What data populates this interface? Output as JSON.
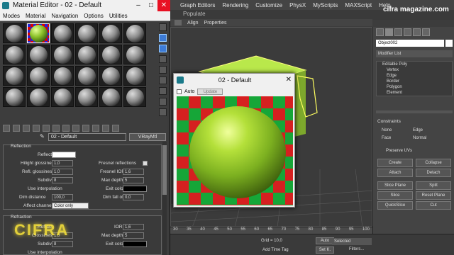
{
  "max": {
    "menu": [
      "Graph Editors",
      "Rendering",
      "Customize",
      "PhysX",
      "MyScripts",
      "MAXScript",
      "Help"
    ],
    "ribbon_text": "Populate",
    "toolbar2": [
      "Align",
      "Properties"
    ],
    "watermark": "cifra magazine.com",
    "cmd": {
      "object_name": "Object002",
      "modifier_list": "Modifier List",
      "stack": [
        "Editable Poly",
        "Vertex",
        "Edge",
        "Border",
        "Polygon",
        "Element"
      ],
      "constraints_label": "Constraints",
      "radio": [
        "None",
        "Edge",
        "Face",
        "Normal"
      ],
      "preserve_uvs": "Preserve UVs",
      "buttons": [
        "Create",
        "Collapse",
        "Attach",
        "Detach",
        "Slice Plane",
        "Split",
        "Slice",
        "Reset Plane",
        "QuickSlice",
        "Cut"
      ]
    },
    "timeline_ticks": [
      "30",
      "35",
      "40",
      "45",
      "50",
      "55",
      "60",
      "65",
      "70",
      "75",
      "80",
      "85",
      "90",
      "95",
      "100"
    ],
    "status": {
      "grid": "Grid = 10,0",
      "auto": "Auto",
      "selected": "Selected",
      "set_k": "Set K.",
      "filters": "Filters...",
      "add_time_tag": "Add Time Tag"
    }
  },
  "me": {
    "title": "Material Editor - 02 - Default",
    "menu": [
      "Modes",
      "Material",
      "Navigation",
      "Options",
      "Utilities"
    ],
    "material_name": "02 - Default",
    "material_type": "VRayMtl",
    "reflection": {
      "section": "Reflection",
      "reflect": "Reflect",
      "hilight": "Hilight glossiness",
      "hilight_val": "1,0",
      "refl_gloss": "Refl. glossiness",
      "refl_gloss_val": "1,0",
      "subdivs": "Subdivs",
      "subdivs_val": "8",
      "use_interp": "Use interpolation",
      "dim_distance": "Dim distance",
      "dim_val": "100,0",
      "affect_channels": "Affect channels",
      "affect_val": "Color only",
      "fresnel": "Fresnel reflections",
      "fresnel_ior": "Fresnel IOR",
      "fresnel_ior_val": "1,6",
      "max_depth": "Max depth",
      "max_depth_val": "5",
      "exit_color": "Exit color",
      "dim_falloff": "Dim fall off",
      "dim_falloff_val": "0,0"
    },
    "refraction": {
      "section": "Refraction",
      "refract": "Refract",
      "glossiness": "Glossiness",
      "glossiness_val": "1,0",
      "subdivs": "Subdivs",
      "subdivs_val": "8",
      "use_interp": "Use interpolation",
      "ior": "IOR",
      "ior_val": "1,6",
      "max_depth": "Max depth",
      "max_depth_val": "5",
      "exit_color": "Exit color"
    }
  },
  "preview": {
    "title": "02 - Default",
    "auto": "Auto",
    "update": "Update"
  },
  "logo": "CIFRA",
  "colors": {
    "reflect_swatch": "#ffffff",
    "exit_swatch": "#000000",
    "refract_swatch": "#000000"
  }
}
